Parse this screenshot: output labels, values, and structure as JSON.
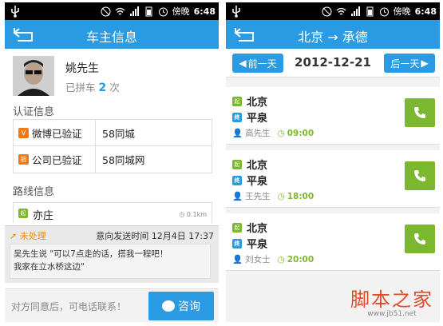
{
  "status_bar": {
    "clock": "6:48",
    "indicator": "傍晚"
  },
  "left": {
    "title": "车主信息",
    "profile": {
      "name": "姚先生",
      "count_prefix": "已拼车",
      "count": "2",
      "count_suffix": "次"
    },
    "verify_title": "认证信息",
    "verify_rows": [
      {
        "label": "微博已验证",
        "value": "58同城",
        "badge_color": "#f07a1a"
      },
      {
        "label": "公司已验证",
        "value": "58同城网",
        "badge_color": "#f07a1a"
      }
    ],
    "route_title": "路线信息",
    "route": {
      "tag": "起",
      "place": "亦庄",
      "distance": "0.1km"
    },
    "notice": {
      "status": "未处理",
      "time": "意向发送时间 12月4日 17:37",
      "message_line1": "吴先生说 \"可以7点走的话，搭我一程吧！",
      "message_line2": "我家在立水桥这边\""
    },
    "footer": {
      "hint": "对方同意后，可电话联系！",
      "button": "咨询"
    }
  },
  "right": {
    "title_from": "北京",
    "title_to": "承德",
    "date": {
      "prev": "前一天",
      "current": "2012-12-21",
      "next": "后一天"
    },
    "trips": [
      {
        "from": "北京",
        "to": "平泉",
        "driver": "高先生",
        "time": "09:00"
      },
      {
        "from": "北京",
        "to": "平泉",
        "driver": "王先生",
        "time": "18:00"
      },
      {
        "from": "北京",
        "to": "平泉",
        "driver": "刘女士",
        "time": "20:00"
      }
    ],
    "tags": {
      "start": "起",
      "end": "终"
    }
  },
  "watermark": {
    "big": "脚本之家",
    "small": "www.jb51.net"
  },
  "colors": {
    "primary": "#2a9be3",
    "accent_green": "#7cb82f",
    "orange": "#f08a00"
  }
}
